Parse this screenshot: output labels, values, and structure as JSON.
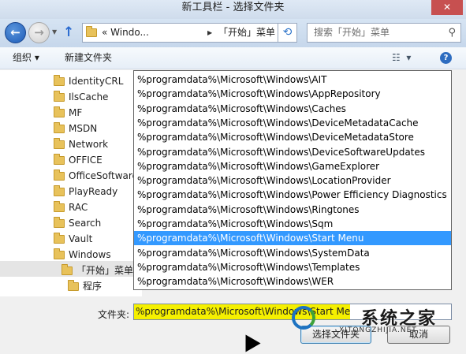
{
  "window": {
    "title": "新工具栏 - 选择文件夹",
    "close_label": "✕"
  },
  "nav": {
    "address_path": "« Windo...",
    "address_current": "「开始」菜单",
    "search_placeholder": "搜索「开始」菜单"
  },
  "toolbar": {
    "organize_label": "组织 ▾",
    "new_folder_label": "新建文件夹"
  },
  "tree": {
    "items": [
      "IdentityCRL",
      "IlsCache",
      "MF",
      "MSDN",
      "Network",
      "OFFICE",
      "OfficeSoftware",
      "PlayReady",
      "RAC",
      "Search",
      "Vault",
      "Windows",
      "「开始」菜单",
      "程序"
    ]
  },
  "dropdown": {
    "items": [
      "%programdata%\\Microsoft\\Windows\\AIT",
      "%programdata%\\Microsoft\\Windows\\AppRepository",
      "%programdata%\\Microsoft\\Windows\\Caches",
      "%programdata%\\Microsoft\\Windows\\DeviceMetadataCache",
      "%programdata%\\Microsoft\\Windows\\DeviceMetadataStore",
      "%programdata%\\Microsoft\\Windows\\DeviceSoftwareUpdates",
      "%programdata%\\Microsoft\\Windows\\GameExplorer",
      "%programdata%\\Microsoft\\Windows\\LocationProvider",
      "%programdata%\\Microsoft\\Windows\\Power Efficiency Diagnostics",
      "%programdata%\\Microsoft\\Windows\\Ringtones",
      "%programdata%\\Microsoft\\Windows\\Sqm",
      "%programdata%\\Microsoft\\Windows\\Start Menu",
      "%programdata%\\Microsoft\\Windows\\SystemData",
      "%programdata%\\Microsoft\\Windows\\Templates",
      "%programdata%\\Microsoft\\Windows\\WER"
    ],
    "selected": "%programdata%\\Microsoft\\Windows\\Start Menu"
  },
  "folder_field": {
    "label": "文件夹:",
    "value": "%programdata%\\Microsoft\\Windows\\Start Me"
  },
  "buttons": {
    "select_folder": "选择文件夹",
    "cancel": "取消"
  },
  "watermark": {
    "text": "系统之家",
    "sub": "XITONGZHIJIA.NET"
  },
  "colors": {
    "selection": "#3399ff",
    "highlight": "#f5f000"
  }
}
